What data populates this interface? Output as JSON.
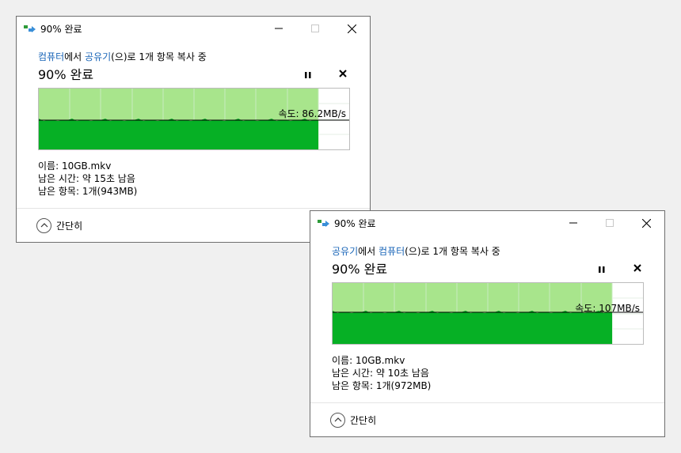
{
  "windows": [
    {
      "title": "90% 완료",
      "subtitle": {
        "from": "컴퓨터",
        "mid1": "에서 ",
        "to": "공유기",
        "rest": "(으)로 1개 항목 복사 중"
      },
      "heading": "90% 완료",
      "speed": "속도: 86.2MB/s",
      "speed_level": 0.48,
      "progress_fraction": 0.9,
      "name_line": "이름: 10GB.mkv",
      "time_line": "남은 시간: 약 15초 남음",
      "items_line": "남은 항목: 1개(943MB)",
      "collapse_label": "간단히"
    },
    {
      "title": "90% 완료",
      "subtitle": {
        "from": "공유기",
        "mid1": "에서 ",
        "to": "컴퓨터",
        "rest": "(으)로 1개 항목 복사 중"
      },
      "heading": "90% 완료",
      "speed": "속도: 107MB/s",
      "speed_level": 0.52,
      "progress_fraction": 0.9,
      "name_line": "이름: 10GB.mkv",
      "time_line": "남은 시간: 약 10초 남음",
      "items_line": "남은 항목: 1개(972MB)",
      "collapse_label": "간단히"
    }
  ],
  "colors": {
    "progress_light": "#a8e58c",
    "progress_dark": "#06b025",
    "link": "#1a66b8"
  },
  "icons": {
    "title": "copy-transfer-icon",
    "minimize": "minimize-icon",
    "maximize": "maximize-icon",
    "close": "close-icon",
    "pause": "pause-icon",
    "cancel": "cancel-icon",
    "collapse": "chevron-up-icon"
  }
}
